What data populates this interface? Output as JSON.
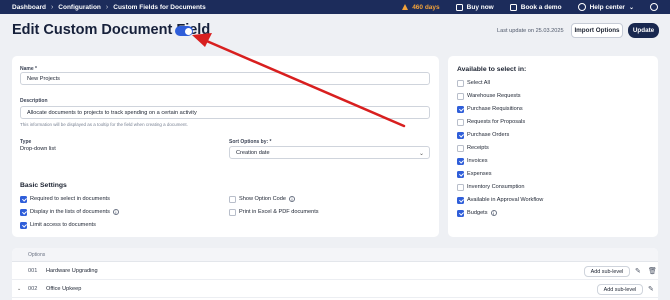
{
  "topbar": {
    "breadcrumbs": [
      "Dashboard",
      "Configuration",
      "Custom Fields for Documents"
    ],
    "days": "460 days",
    "buy_now": "Buy now",
    "book_demo": "Book a demo",
    "help": "Help center"
  },
  "header": {
    "title": "Edit Custom Document Field",
    "last_update": "Last update on 25.03.2025",
    "import_label": "Import Options",
    "update_label": "Update"
  },
  "form": {
    "name_label": "Name *",
    "name_value": "New Projects",
    "desc_label": "Description",
    "desc_value": "Allocate documents to projects to track spending on a certain activity",
    "desc_hint": "This information will be displayed as a tooltip for the field when creating a document.",
    "type_label": "Type",
    "type_value": "Drop-down list",
    "sort_label": "Sort Options by: *",
    "sort_value": "Creation date"
  },
  "basic": {
    "title": "Basic Settings",
    "items": [
      {
        "label": "Required to select in documents",
        "checked": true
      },
      {
        "label": "Display in the lists of documents",
        "checked": true
      },
      {
        "label": "Limit access to documents",
        "checked": true
      },
      {
        "label": "Show Option Code",
        "checked": false
      },
      {
        "label": "Print in Excel & PDF documents",
        "checked": false
      }
    ]
  },
  "available": {
    "title": "Available to select in:",
    "items": [
      {
        "label": "Select All",
        "checked": false
      },
      {
        "label": "Warehouse Requests",
        "checked": false
      },
      {
        "label": "Purchase Requisitions",
        "checked": true
      },
      {
        "label": "Requests for Proposals",
        "checked": false
      },
      {
        "label": "Purchase Orders",
        "checked": true
      },
      {
        "label": "Receipts",
        "checked": false
      },
      {
        "label": "Invoices",
        "checked": true
      },
      {
        "label": "Expenses",
        "checked": true
      },
      {
        "label": "Inventory Consumption",
        "checked": false
      },
      {
        "label": "Available in Approval Workflow",
        "checked": true
      },
      {
        "label": "Budgets",
        "checked": true
      }
    ]
  },
  "options": {
    "header": "Options",
    "rows": [
      {
        "code": "001",
        "name": "Hardware Upgrading",
        "action": "Add sub-level"
      },
      {
        "code": "002",
        "name": "Office Upkeep",
        "action": "Add sub-level"
      }
    ]
  },
  "colors": {
    "accent": "#2f5ed9",
    "navy": "#1c2c5b",
    "arrow": "#d81f1f"
  }
}
